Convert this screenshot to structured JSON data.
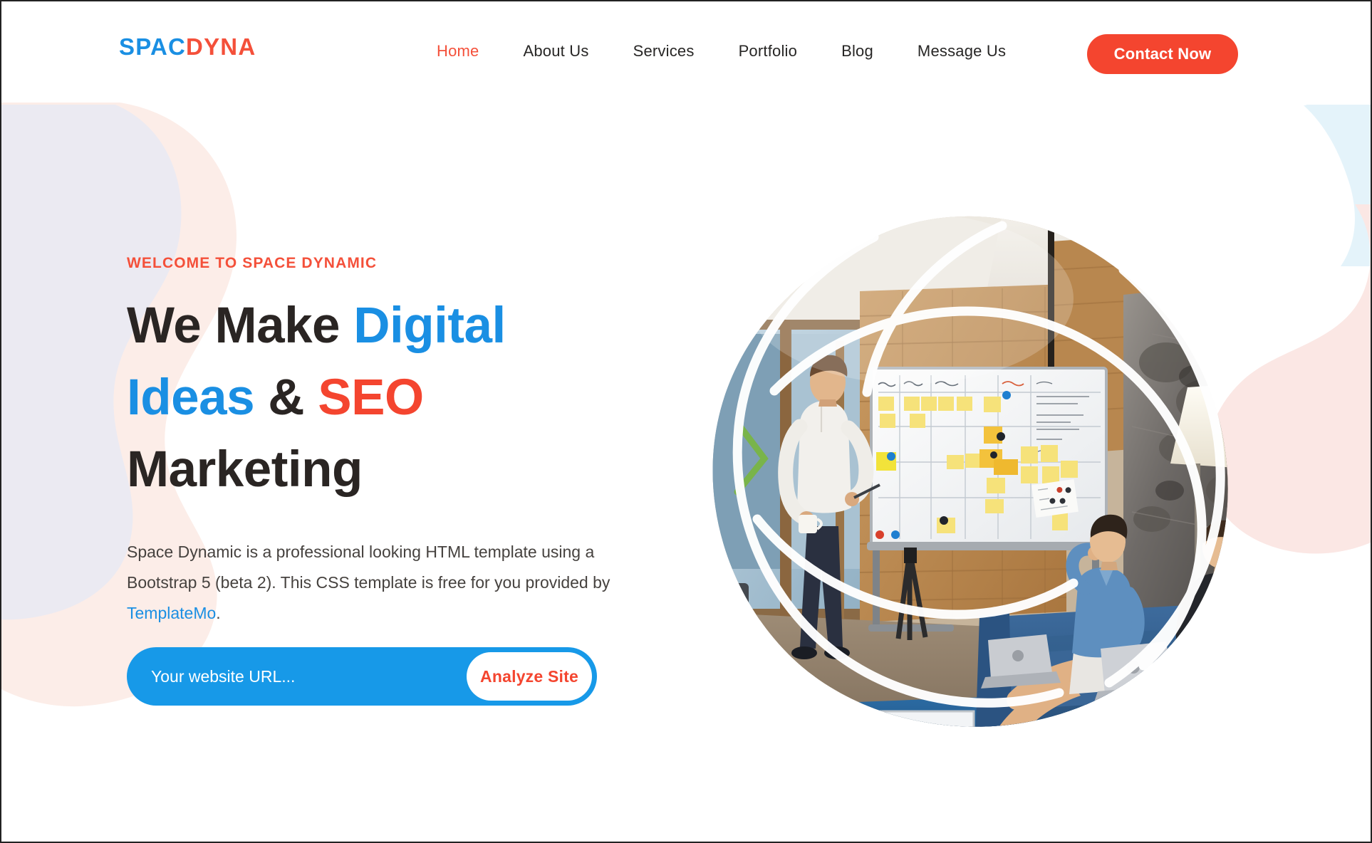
{
  "brand": {
    "logo_part_one": "SPAC",
    "logo_part_two": "DYNA",
    "blue": "#1A8FE3",
    "red": "#F4452F",
    "dark": "#2A2523"
  },
  "header": {
    "nav_items": [
      {
        "label": "Home",
        "active": true
      },
      {
        "label": "About Us",
        "active": false
      },
      {
        "label": "Services",
        "active": false
      },
      {
        "label": "Portfolio",
        "active": false
      },
      {
        "label": "Blog",
        "active": false
      },
      {
        "label": "Message Us",
        "active": false
      }
    ],
    "cta_label": "Contact Now"
  },
  "hero": {
    "eyebrow": "WELCOME TO SPACE DYNAMIC",
    "heading": {
      "line1_dark": "We Make ",
      "line1_blue": "Digital",
      "line2_blue": "Ideas",
      "line2_amp": " & ",
      "line2_red": "SEO",
      "line3_dark": "Marketing"
    },
    "paragraph_part1": "Space Dynamic is a professional looking HTML template using a Bootstrap 5 (beta 2). This CSS template is free for you provided by ",
    "paragraph_link": "TemplateMo",
    "paragraph_part2": ".",
    "form": {
      "input_value": "",
      "input_placeholder": "Your website URL...",
      "submit_label": "Analyze Site"
    },
    "image_alt": "office-team-meeting-whiteboard-photo"
  },
  "decor": {
    "lavender": "#EBEAF2",
    "peach": "#FCEDE8",
    "pink": "#FBE7E4",
    "lightblue": "#E4F3FA"
  }
}
